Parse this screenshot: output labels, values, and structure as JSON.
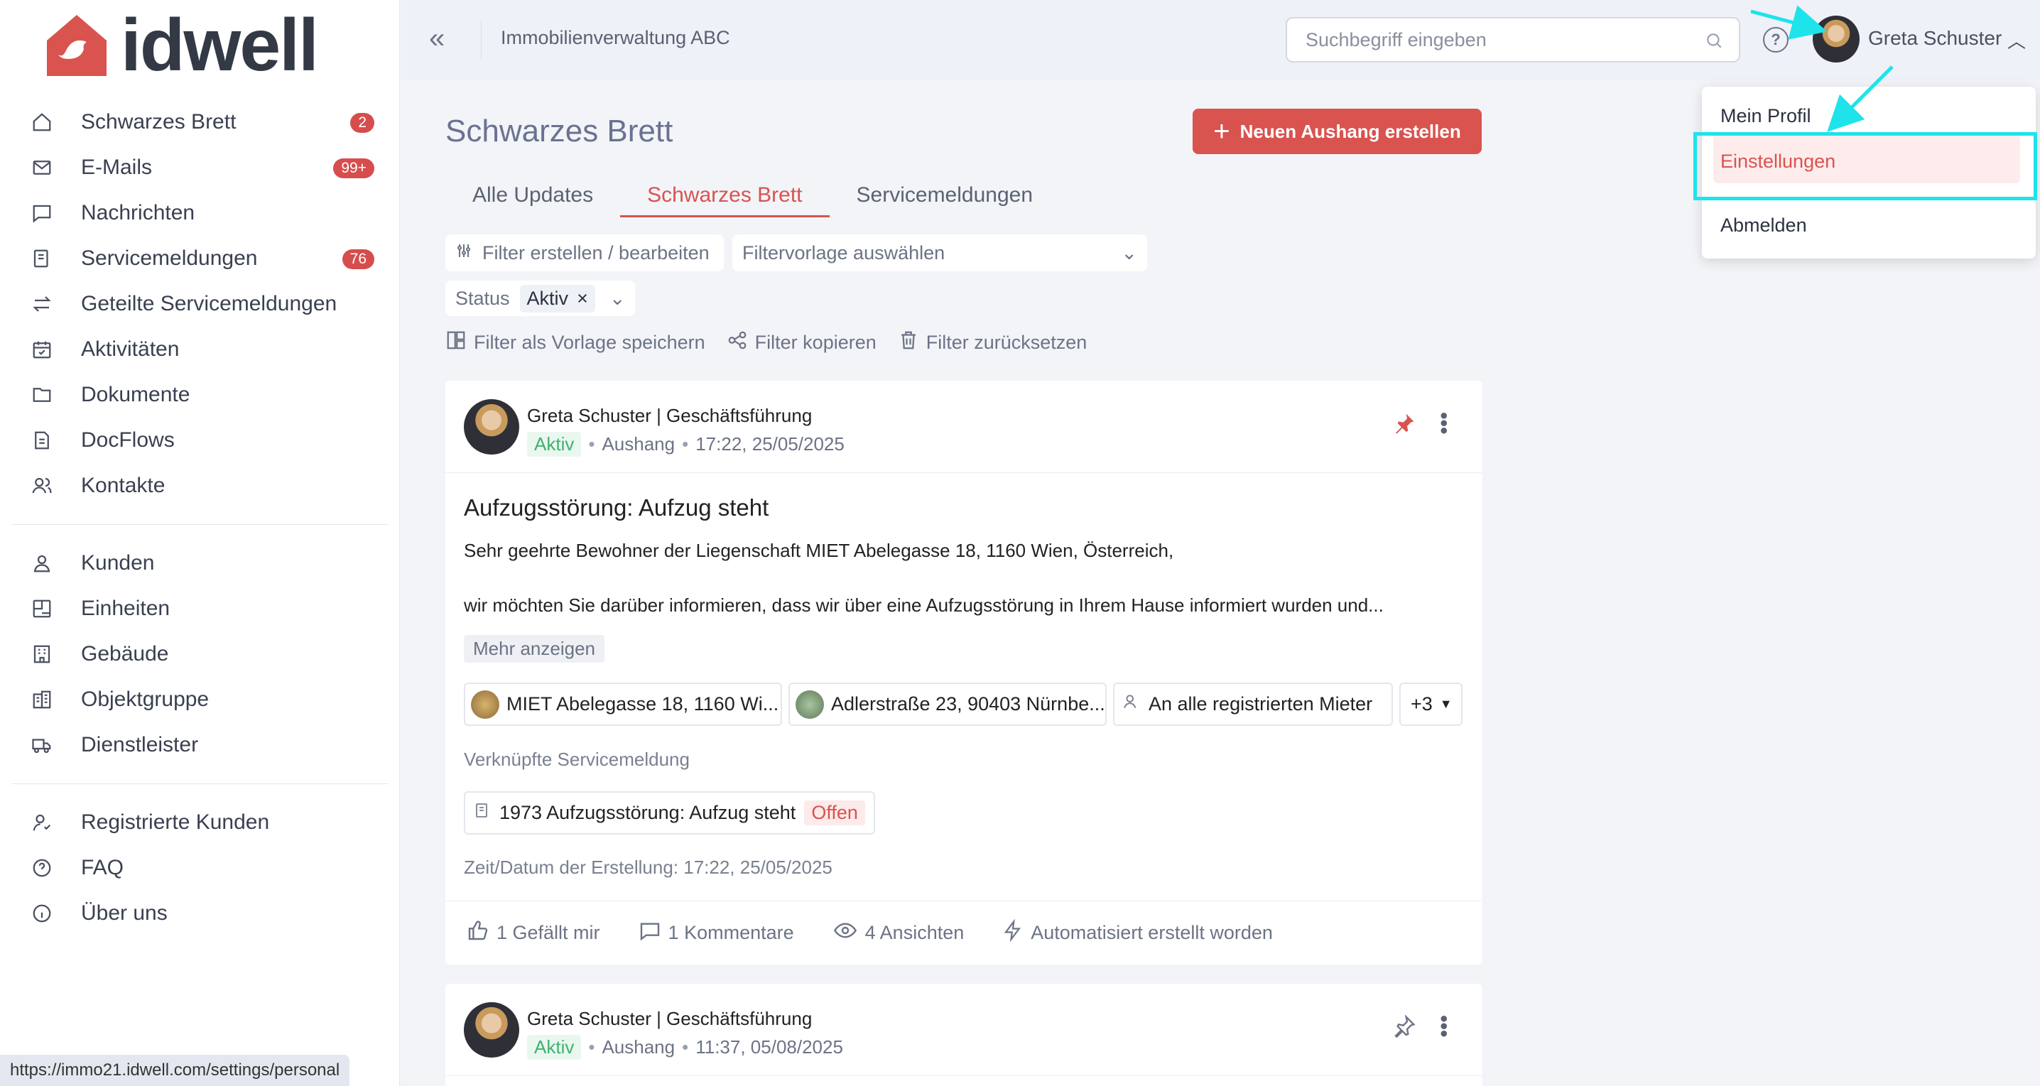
{
  "app": {
    "brand": "idwell",
    "organization": "Immobilienverwaltung ABC"
  },
  "sidebar": {
    "group1": [
      {
        "label": "Schwarzes Brett",
        "icon": "home-icon",
        "badge": "2"
      },
      {
        "label": "E-Mails",
        "icon": "mail-icon",
        "badge": "99+"
      },
      {
        "label": "Nachrichten",
        "icon": "chat-icon",
        "badge": ""
      },
      {
        "label": "Servicemeldungen",
        "icon": "service-icon",
        "badge": "76"
      },
      {
        "label": "Geteilte Servicemeldungen",
        "icon": "exchange-icon",
        "badge": ""
      },
      {
        "label": "Aktivitäten",
        "icon": "calendar-icon",
        "badge": ""
      },
      {
        "label": "Dokumente",
        "icon": "folder-icon",
        "badge": ""
      },
      {
        "label": "DocFlows",
        "icon": "docflow-icon",
        "badge": ""
      },
      {
        "label": "Kontakte",
        "icon": "contacts-icon",
        "badge": ""
      }
    ],
    "group2": [
      {
        "label": "Kunden",
        "icon": "user-icon"
      },
      {
        "label": "Einheiten",
        "icon": "unit-icon"
      },
      {
        "label": "Gebäude",
        "icon": "building-icon"
      },
      {
        "label": "Objektgruppe",
        "icon": "object-group-icon"
      },
      {
        "label": "Dienstleister",
        "icon": "truck-icon"
      }
    ],
    "group3": [
      {
        "label": "Registrierte Kunden",
        "icon": "registered-user-icon"
      },
      {
        "label": "FAQ",
        "icon": "faq-icon"
      },
      {
        "label": "Über uns",
        "icon": "info-icon"
      }
    ]
  },
  "header": {
    "search_placeholder": "Suchbegriff eingeben",
    "user_name": "Greta Schuster"
  },
  "user_menu": {
    "items": [
      "Mein Profil",
      "Einstellungen",
      "Abmelden"
    ],
    "highlighted": "Einstellungen"
  },
  "page": {
    "title": "Schwarzes Brett",
    "create_button": "Neuen Aushang erstellen",
    "tabs": [
      "Alle Updates",
      "Schwarzes Brett",
      "Servicemeldungen"
    ],
    "active_tab": "Schwarzes Brett",
    "filter_button": "Filter erstellen / bearbeiten",
    "filter_template_placeholder": "Filtervorlage auswählen",
    "status_label": "Status",
    "status_value": "Aktiv",
    "actions": [
      "Filter als Vorlage speichern",
      "Filter kopieren",
      "Filter zurücksetzen"
    ]
  },
  "posts": [
    {
      "author": "Greta Schuster | Geschäftsführung",
      "status": "Aktiv",
      "type": "Aushang",
      "datetime": "17:22, 25/05/2025",
      "title": "Aufzugsstörung: Aufzug steht",
      "line1": "Sehr geehrte Bewohner der Liegenschaft MIET Abelegasse 18, 1160 Wien, Österreich,",
      "line2": "wir möchten Sie darüber informieren, dass wir über eine Aufzugsstörung in Ihrem Hause informiert wurden und...",
      "more": "Mehr anzeigen",
      "tags": [
        "MIET Abelegasse 18, 1160 Wi...",
        "Adlerstraße 23, 90403 Nürnbe...",
        "An alle registrierten Mieter"
      ],
      "tags_more": "+3",
      "linked_label": "Verknüpfte Servicemeldung",
      "linked_item": "1973 Aufzugsstörung: Aufzug steht",
      "linked_status": "Offen",
      "created": "Zeit/Datum der Erstellung: 17:22, 25/05/2025",
      "likes": "1 Gefällt mir",
      "comments": "1 Kommentare",
      "views": "4 Ansichten",
      "auto": "Automatisiert erstellt worden"
    },
    {
      "author": "Greta Schuster | Geschäftsführung",
      "status": "Aktiv",
      "type": "Aushang",
      "datetime": "11:37, 05/08/2025"
    }
  ],
  "statusbar": {
    "url": "https://immo21.idwell.com/settings/personal"
  },
  "colors": {
    "accent": "#d9534f",
    "highlight_box": "#1ee3ea",
    "active_green": "#3fb26f"
  }
}
